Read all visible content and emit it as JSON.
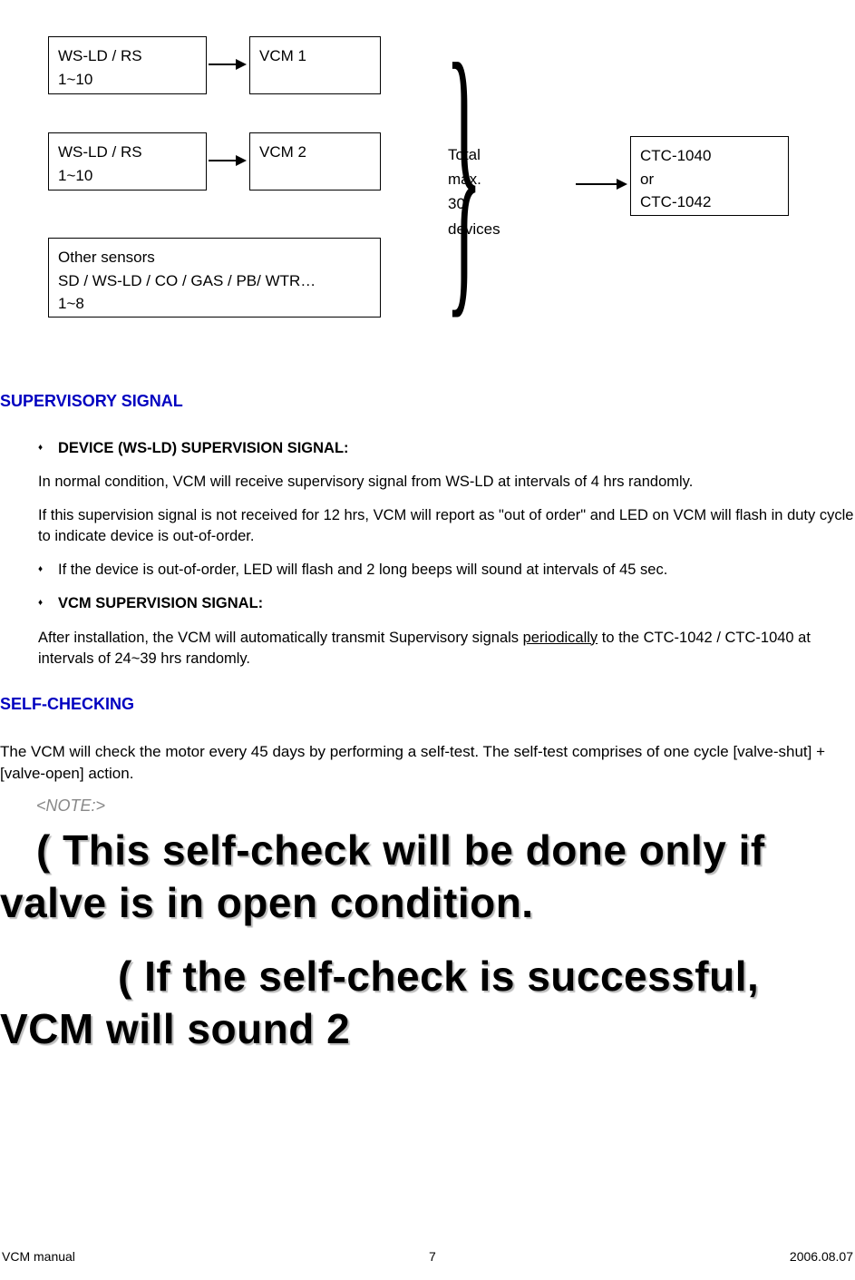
{
  "diagram": {
    "ws1_line1": "WS-LD / RS",
    "ws1_line2": "1~10",
    "ws2_line1": "WS-LD / RS",
    "ws2_line2": "1~10",
    "vcm1": "VCM 1",
    "vcm2": "VCM 2",
    "other_line1": "Other sensors",
    "other_line2": "SD / WS-LD / CO / GAS / PB/ WTR…",
    "other_line3": "1~8",
    "total_line1": "Total",
    "total_line2": "max.",
    "total_line3": "30",
    "total_line4": "devices",
    "ctc_line1": "CTC-1040",
    "ctc_line2": "or",
    "ctc_line3": "CTC-1042"
  },
  "sections": {
    "supervisory_title": "SUPERVISORY SIGNAL",
    "device_sup_heading": "DEVICE (WS-LD) SUPERVISION SIGNAL:",
    "device_sup_p1": "In normal condition, VCM will receive supervisory signal from WS-LD at intervals of 4 hrs randomly.",
    "device_sup_p2": "If this supervision signal is not received for 12 hrs, VCM will report as \"out of order\" and LED on VCM will flash in duty cycle to indicate device is out-of-order.",
    "device_sup_p3": "If the device is out-of-order, LED will flash and 2 long beeps will sound at intervals of 45 sec.",
    "vcm_sup_heading": "VCM SUPERVISION SIGNAL:",
    "vcm_sup_p1a": "After installation, the VCM will automatically transmit Supervisory signals ",
    "vcm_sup_p1b": "periodically",
    "vcm_sup_p1c": " to the CTC-1042 / CTC-1040 at intervals of 24~39 hrs randomly.",
    "selfcheck_title": "SELF-CHECKING",
    "selfcheck_p1": "The VCM will check the motor every 45 days by performing a self-test.    The self-test comprises of one cycle [valve-shut] + [valve-open] action.",
    "note_label": "<NOTE:>",
    "big_note_1": "( This self-check will be done only if valve is in open condition.",
    "big_note_2": "( If the self-check is successful, VCM will sound 2"
  },
  "footer": {
    "left": "VCM manual",
    "center": "7",
    "right": "2006.08.07"
  }
}
